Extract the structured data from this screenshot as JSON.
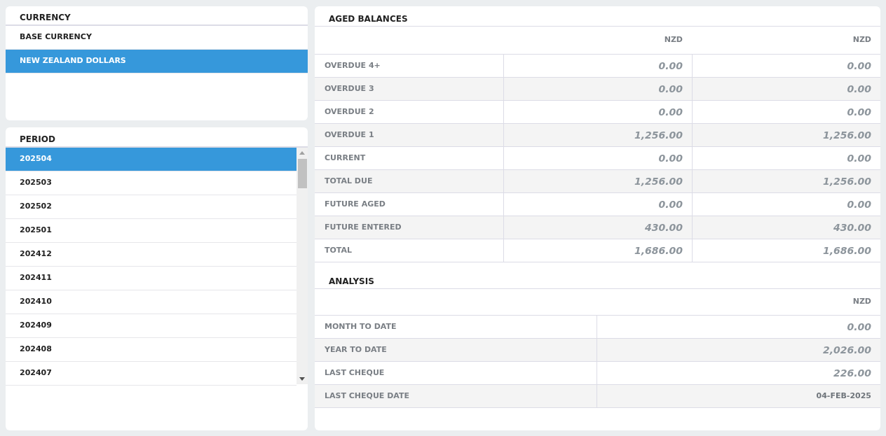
{
  "currency": {
    "title": "CURRENCY",
    "items": [
      {
        "label": "BASE CURRENCY",
        "selected": false
      },
      {
        "label": "NEW ZEALAND DOLLARS",
        "selected": true
      }
    ]
  },
  "period": {
    "title": "PERIOD",
    "items": [
      {
        "label": "202504",
        "selected": true
      },
      {
        "label": "202503",
        "selected": false
      },
      {
        "label": "202502",
        "selected": false
      },
      {
        "label": "202501",
        "selected": false
      },
      {
        "label": "202412",
        "selected": false
      },
      {
        "label": "202411",
        "selected": false
      },
      {
        "label": "202410",
        "selected": false
      },
      {
        "label": "202409",
        "selected": false
      },
      {
        "label": "202408",
        "selected": false
      },
      {
        "label": "202407",
        "selected": false
      }
    ]
  },
  "aged_balances": {
    "title": "AGED BALANCES",
    "columns": [
      "NZD",
      "NZD"
    ],
    "rows": [
      {
        "label": "OVERDUE 4+",
        "values": [
          "0.00",
          "0.00"
        ]
      },
      {
        "label": "OVERDUE 3",
        "values": [
          "0.00",
          "0.00"
        ]
      },
      {
        "label": "OVERDUE 2",
        "values": [
          "0.00",
          "0.00"
        ]
      },
      {
        "label": "OVERDUE 1",
        "values": [
          "1,256.00",
          "1,256.00"
        ]
      },
      {
        "label": "CURRENT",
        "values": [
          "0.00",
          "0.00"
        ]
      },
      {
        "label": "TOTAL DUE",
        "values": [
          "1,256.00",
          "1,256.00"
        ]
      },
      {
        "label": "FUTURE AGED",
        "values": [
          "0.00",
          "0.00"
        ]
      },
      {
        "label": "FUTURE ENTERED",
        "values": [
          "430.00",
          "430.00"
        ]
      },
      {
        "label": "TOTAL",
        "values": [
          "1,686.00",
          "1,686.00"
        ]
      }
    ]
  },
  "analysis": {
    "title": "ANALYSIS",
    "columns": [
      "NZD"
    ],
    "rows": [
      {
        "label": "MONTH TO DATE",
        "value": "0.00",
        "kind": "amount"
      },
      {
        "label": "YEAR TO DATE",
        "value": "2,026.00",
        "kind": "amount"
      },
      {
        "label": "LAST CHEQUE",
        "value": "226.00",
        "kind": "amount"
      },
      {
        "label": "LAST CHEQUE DATE",
        "value": "04-FEB-2025",
        "kind": "date"
      }
    ]
  }
}
